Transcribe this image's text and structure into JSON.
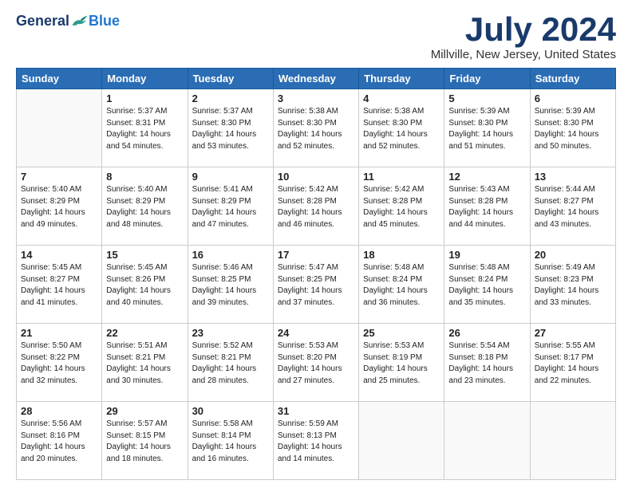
{
  "header": {
    "logo_general": "General",
    "logo_blue": "Blue",
    "month_title": "July 2024",
    "location": "Millville, New Jersey, United States"
  },
  "weekdays": [
    "Sunday",
    "Monday",
    "Tuesday",
    "Wednesday",
    "Thursday",
    "Friday",
    "Saturday"
  ],
  "weeks": [
    [
      {
        "day": "",
        "info": ""
      },
      {
        "day": "1",
        "info": "Sunrise: 5:37 AM\nSunset: 8:31 PM\nDaylight: 14 hours\nand 54 minutes."
      },
      {
        "day": "2",
        "info": "Sunrise: 5:37 AM\nSunset: 8:30 PM\nDaylight: 14 hours\nand 53 minutes."
      },
      {
        "day": "3",
        "info": "Sunrise: 5:38 AM\nSunset: 8:30 PM\nDaylight: 14 hours\nand 52 minutes."
      },
      {
        "day": "4",
        "info": "Sunrise: 5:38 AM\nSunset: 8:30 PM\nDaylight: 14 hours\nand 52 minutes."
      },
      {
        "day": "5",
        "info": "Sunrise: 5:39 AM\nSunset: 8:30 PM\nDaylight: 14 hours\nand 51 minutes."
      },
      {
        "day": "6",
        "info": "Sunrise: 5:39 AM\nSunset: 8:30 PM\nDaylight: 14 hours\nand 50 minutes."
      }
    ],
    [
      {
        "day": "7",
        "info": "Sunrise: 5:40 AM\nSunset: 8:29 PM\nDaylight: 14 hours\nand 49 minutes."
      },
      {
        "day": "8",
        "info": "Sunrise: 5:40 AM\nSunset: 8:29 PM\nDaylight: 14 hours\nand 48 minutes."
      },
      {
        "day": "9",
        "info": "Sunrise: 5:41 AM\nSunset: 8:29 PM\nDaylight: 14 hours\nand 47 minutes."
      },
      {
        "day": "10",
        "info": "Sunrise: 5:42 AM\nSunset: 8:28 PM\nDaylight: 14 hours\nand 46 minutes."
      },
      {
        "day": "11",
        "info": "Sunrise: 5:42 AM\nSunset: 8:28 PM\nDaylight: 14 hours\nand 45 minutes."
      },
      {
        "day": "12",
        "info": "Sunrise: 5:43 AM\nSunset: 8:28 PM\nDaylight: 14 hours\nand 44 minutes."
      },
      {
        "day": "13",
        "info": "Sunrise: 5:44 AM\nSunset: 8:27 PM\nDaylight: 14 hours\nand 43 minutes."
      }
    ],
    [
      {
        "day": "14",
        "info": "Sunrise: 5:45 AM\nSunset: 8:27 PM\nDaylight: 14 hours\nand 41 minutes."
      },
      {
        "day": "15",
        "info": "Sunrise: 5:45 AM\nSunset: 8:26 PM\nDaylight: 14 hours\nand 40 minutes."
      },
      {
        "day": "16",
        "info": "Sunrise: 5:46 AM\nSunset: 8:25 PM\nDaylight: 14 hours\nand 39 minutes."
      },
      {
        "day": "17",
        "info": "Sunrise: 5:47 AM\nSunset: 8:25 PM\nDaylight: 14 hours\nand 37 minutes."
      },
      {
        "day": "18",
        "info": "Sunrise: 5:48 AM\nSunset: 8:24 PM\nDaylight: 14 hours\nand 36 minutes."
      },
      {
        "day": "19",
        "info": "Sunrise: 5:48 AM\nSunset: 8:24 PM\nDaylight: 14 hours\nand 35 minutes."
      },
      {
        "day": "20",
        "info": "Sunrise: 5:49 AM\nSunset: 8:23 PM\nDaylight: 14 hours\nand 33 minutes."
      }
    ],
    [
      {
        "day": "21",
        "info": "Sunrise: 5:50 AM\nSunset: 8:22 PM\nDaylight: 14 hours\nand 32 minutes."
      },
      {
        "day": "22",
        "info": "Sunrise: 5:51 AM\nSunset: 8:21 PM\nDaylight: 14 hours\nand 30 minutes."
      },
      {
        "day": "23",
        "info": "Sunrise: 5:52 AM\nSunset: 8:21 PM\nDaylight: 14 hours\nand 28 minutes."
      },
      {
        "day": "24",
        "info": "Sunrise: 5:53 AM\nSunset: 8:20 PM\nDaylight: 14 hours\nand 27 minutes."
      },
      {
        "day": "25",
        "info": "Sunrise: 5:53 AM\nSunset: 8:19 PM\nDaylight: 14 hours\nand 25 minutes."
      },
      {
        "day": "26",
        "info": "Sunrise: 5:54 AM\nSunset: 8:18 PM\nDaylight: 14 hours\nand 23 minutes."
      },
      {
        "day": "27",
        "info": "Sunrise: 5:55 AM\nSunset: 8:17 PM\nDaylight: 14 hours\nand 22 minutes."
      }
    ],
    [
      {
        "day": "28",
        "info": "Sunrise: 5:56 AM\nSunset: 8:16 PM\nDaylight: 14 hours\nand 20 minutes."
      },
      {
        "day": "29",
        "info": "Sunrise: 5:57 AM\nSunset: 8:15 PM\nDaylight: 14 hours\nand 18 minutes."
      },
      {
        "day": "30",
        "info": "Sunrise: 5:58 AM\nSunset: 8:14 PM\nDaylight: 14 hours\nand 16 minutes."
      },
      {
        "day": "31",
        "info": "Sunrise: 5:59 AM\nSunset: 8:13 PM\nDaylight: 14 hours\nand 14 minutes."
      },
      {
        "day": "",
        "info": ""
      },
      {
        "day": "",
        "info": ""
      },
      {
        "day": "",
        "info": ""
      }
    ]
  ]
}
